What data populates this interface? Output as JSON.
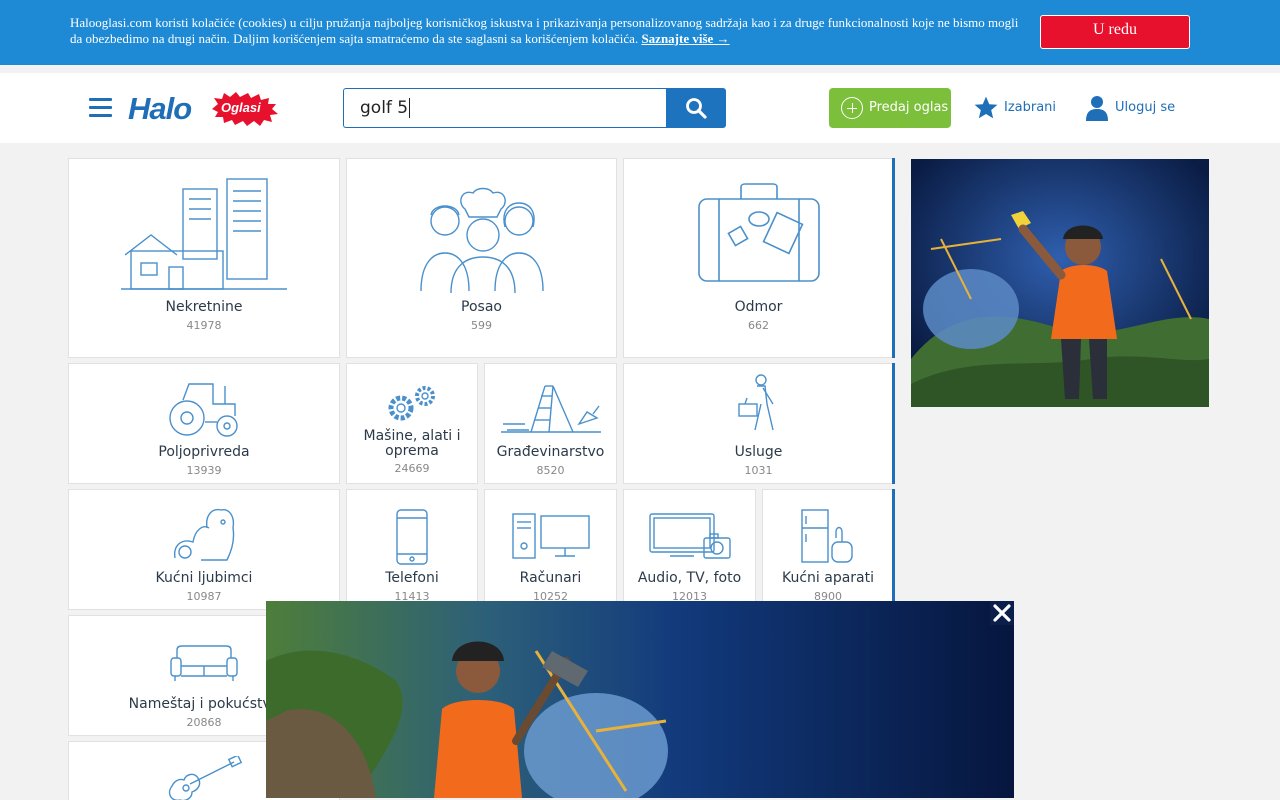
{
  "cookie": {
    "text": "Halooglasi.com koristi kolačiće (cookies) u cilju pružanja najboljeg korisničkog iskustva i prikazivanja personalizovanog sadržaja kao i za druge funkcionalnosti koje ne bismo mogli da obezbedimo na drugi način. Daljim korišćenjem sajta smatraćemo da ste saglasni sa korišćenjem kolačića.",
    "link": "Saznajte više →",
    "accept": "U redu"
  },
  "header": {
    "logo_main": "Halo",
    "logo_sub": "Oglasi",
    "search_value": "golf 5",
    "post_label": "Predaj oglas",
    "favorites_label": "Izabrani",
    "login_label": "Uloguj se"
  },
  "categories": [
    {
      "name": "Nekretnine",
      "count": "41978",
      "icon": "building-house-icon"
    },
    {
      "name": "Posao",
      "count": "599",
      "icon": "workers-icon"
    },
    {
      "name": "Odmor",
      "count": "662",
      "icon": "suitcase-icon"
    },
    {
      "name": "Poljoprivreda",
      "count": "13939",
      "icon": "tractor-icon"
    },
    {
      "name": "Mašine, alati i oprema",
      "count": "24669",
      "icon": "gears-icon"
    },
    {
      "name": "Građevinarstvo",
      "count": "8520",
      "icon": "ladder-trowel-icon"
    },
    {
      "name": "Usluge",
      "count": "1031",
      "icon": "worker-toolbox-icon"
    },
    {
      "name": "Kućni ljubimci",
      "count": "10987",
      "icon": "pets-icon"
    },
    {
      "name": "Telefoni",
      "count": "11413",
      "icon": "phone-icon"
    },
    {
      "name": "Računari",
      "count": "10252",
      "icon": "computer-icon"
    },
    {
      "name": "Audio, TV, foto",
      "count": "12013",
      "icon": "tv-camera-icon"
    },
    {
      "name": "Kućni aparati",
      "count": "8900",
      "icon": "appliances-icon"
    },
    {
      "name": "Nameštaj i pokućstvo",
      "count": "20868",
      "icon": "sofa-icon"
    },
    {
      "name": "",
      "count": "",
      "icon": "guitar-icon"
    }
  ],
  "colors": {
    "primary": "#1e6fb8",
    "cookie_bg": "#1e8ad6",
    "accept_red": "#e8112d",
    "post_green": "#7cbf3b"
  }
}
